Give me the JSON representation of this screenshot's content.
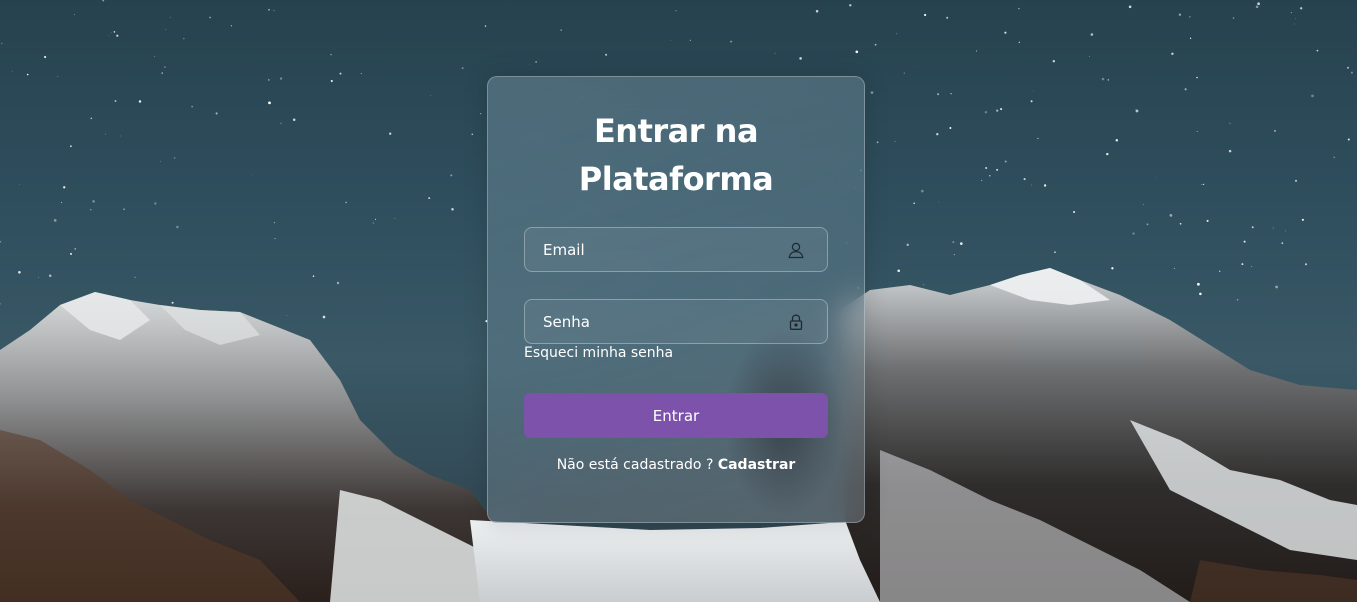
{
  "login": {
    "title_line1": "Entrar na",
    "title_line2": "Plataforma",
    "email_placeholder": "Email",
    "email_icon": "user-icon",
    "password_placeholder": "Senha",
    "password_icon": "lock-icon",
    "forgot_password": "Esqueci minha senha",
    "submit_label": "Entrar",
    "register_prompt": "Não está cadastrado ?",
    "register_link": "Cadastrar"
  },
  "colors": {
    "button": "#7d52ab",
    "text": "#ffffff",
    "sky": "#2f4f5e"
  }
}
